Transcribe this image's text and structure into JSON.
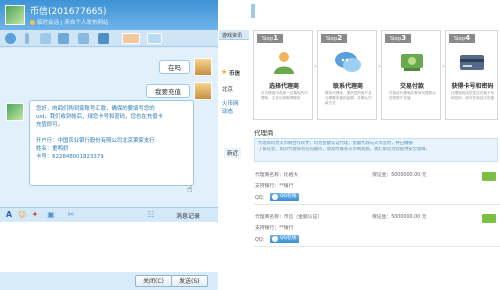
{
  "chat": {
    "title": "币信(201677665)",
    "subtitle": "临时会话 | 来自个人发布网站",
    "messages_out": [
      "在吗",
      "我要充值"
    ],
    "message_in": [
      "您好，肉鸽们购到家账号汇款，确保的要填写您的",
      "uid，我们收到帐后，绿您卡号和密码，您也在充值卡",
      "充值即可。",
      "",
      "开户行：中国农业银行股份有限公司北京萧家支行",
      "姓名：童鸭娇",
      "卡号：622848001823379"
    ],
    "history_label": "消息记录",
    "buttons": {
      "close": "关闭(C)",
      "send": "发送(S)"
    }
  },
  "middle_panel": {
    "tab": "游戏资讯",
    "entry_name": "币信",
    "line1": "北京",
    "line2": "火币网",
    "line3": "动态",
    "link": "新近"
  },
  "steps": [
    {
      "badge_word": "Step",
      "number": "1",
      "title": "选择代理商",
      "desc": "在代理商中选择一位喜欢的代理商，主动与其取得联系"
    },
    {
      "badge_word": "Step",
      "number": "2",
      "title": "联系代理商",
      "desc": "联系代理商，提供您的用户名与需要充值的金额，并确认付款方式"
    },
    {
      "badge_word": "Step",
      "number": "3",
      "title": "交易付款",
      "desc": "付款给代理商并等待代理商为您的账户充值"
    },
    {
      "badge_word": "Step",
      "number": "4",
      "title": "获得卡号和密码",
      "desc": "代理商将给您发送充值卡号和密码，即可在网站中充值"
    }
  ],
  "agents_section": {
    "title": "代理商",
    "notice": [
      "代理商均为火币网合作伙伴，均为金额认证代理，金额代理与火币签约，并已缴纳",
      "了保证金，如对代理商有任何疑问，请及时联系火币网客服，我们承诺为您提供安全保障。"
    ],
    "agents": [
      {
        "name_label": "代理商名称：",
        "name": "比格大",
        "deposit_label": "保证金：",
        "deposit": "5000000.00 元",
        "bank_label": "支持银行：",
        "bank": "**银行",
        "qq_label": "QQ：",
        "qq_button": "QQ在线"
      },
      {
        "name_label": "代理商名称：",
        "name": "币信（金额认证）",
        "deposit_label": "保证金：",
        "deposit": "5000000.00 元",
        "bank_label": "支持银行：",
        "bank": "**银行",
        "qq_label": "QQ：",
        "qq_button": "QQ在线"
      }
    ]
  },
  "colors": {
    "accent": "#3e93d6",
    "chat_bg": "#e2f0fb",
    "notice_bg": "#e8f3fc",
    "link_green": "#7bc043"
  }
}
